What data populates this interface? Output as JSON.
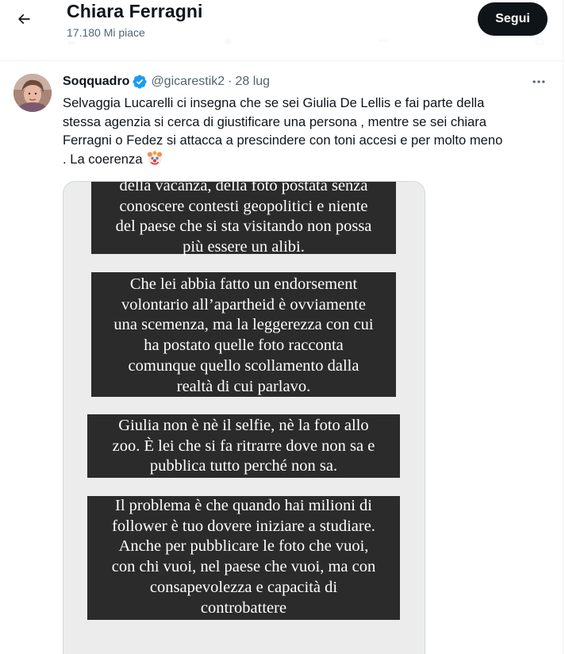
{
  "header": {
    "profile_name": "Chiara Ferragni",
    "likes_count": "17.180 Mi piace",
    "follow_label": "Segui"
  },
  "tweet": {
    "display_name": "Soqquadro",
    "handle": "@gicarestik2",
    "separator": "·",
    "date": "28 lug",
    "text_lines": [
      "Selvaggia Lucarelli ci insegna che se sei Giulia De Lellis e fai parte della",
      "stessa agenzia si cerca di giustificare una persona , mentre se sei chiara",
      "Ferragni o Fedez si attacca a prescindere con toni accesi e per molto meno",
      ". La coerenza"
    ],
    "emoji": "clown-face-emoji"
  },
  "media": {
    "blocks": [
      {
        "lines": [
          "della vacanza, della foto postata senza",
          "conoscere contesti geopolitici e niente",
          "del paese che si sta visitando non possa",
          "più essere un alibi."
        ]
      },
      {
        "lines": [
          "Che lei abbia fatto un endorsement",
          "volontario all’apartheid è ovviamente",
          "una scemenza, ma la leggerezza con cui",
          "ha postato quelle foto racconta",
          "comunque quello scollamento dalla",
          "realtà di cui parlavo."
        ]
      },
      {
        "lines": [
          "Giulia non è nè il selfie, nè la foto allo",
          "zoo. È lei che si fa ritrarre dove non sa e",
          "pubblica tutto perché non sa."
        ]
      },
      {
        "lines": [
          "Il problema è che quando hai milioni di",
          "follower è tuo dovere iniziare a studiare.",
          "Anche per pubblicare le foto che vuoi,",
          "con chi vuoi, nel paese che vuoi, ma con",
          "consapevolezza e capacità di",
          "controbattere"
        ]
      }
    ]
  },
  "colors": {
    "text_primary": "#0f1419",
    "text_secondary": "#536471",
    "verified_blue": "#1d9bf0",
    "follow_button_bg": "#0f1419",
    "story_block_bg": "#2b2b2b",
    "media_bg": "#ececec"
  },
  "icons": [
    "back-arrow-icon",
    "verified-badge-icon",
    "more-options-icon"
  ]
}
